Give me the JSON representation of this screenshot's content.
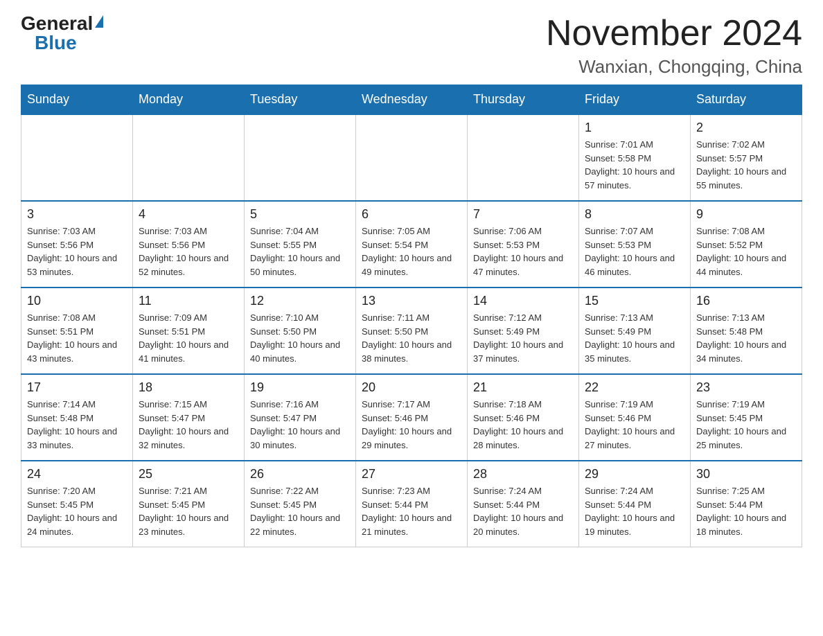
{
  "logo": {
    "general_text": "General",
    "blue_text": "Blue"
  },
  "header": {
    "month_year": "November 2024",
    "location": "Wanxian, Chongqing, China"
  },
  "weekdays": [
    "Sunday",
    "Monday",
    "Tuesday",
    "Wednesday",
    "Thursday",
    "Friday",
    "Saturday"
  ],
  "weeks": [
    [
      {
        "day": "",
        "info": ""
      },
      {
        "day": "",
        "info": ""
      },
      {
        "day": "",
        "info": ""
      },
      {
        "day": "",
        "info": ""
      },
      {
        "day": "",
        "info": ""
      },
      {
        "day": "1",
        "info": "Sunrise: 7:01 AM\nSunset: 5:58 PM\nDaylight: 10 hours and 57 minutes."
      },
      {
        "day": "2",
        "info": "Sunrise: 7:02 AM\nSunset: 5:57 PM\nDaylight: 10 hours and 55 minutes."
      }
    ],
    [
      {
        "day": "3",
        "info": "Sunrise: 7:03 AM\nSunset: 5:56 PM\nDaylight: 10 hours and 53 minutes."
      },
      {
        "day": "4",
        "info": "Sunrise: 7:03 AM\nSunset: 5:56 PM\nDaylight: 10 hours and 52 minutes."
      },
      {
        "day": "5",
        "info": "Sunrise: 7:04 AM\nSunset: 5:55 PM\nDaylight: 10 hours and 50 minutes."
      },
      {
        "day": "6",
        "info": "Sunrise: 7:05 AM\nSunset: 5:54 PM\nDaylight: 10 hours and 49 minutes."
      },
      {
        "day": "7",
        "info": "Sunrise: 7:06 AM\nSunset: 5:53 PM\nDaylight: 10 hours and 47 minutes."
      },
      {
        "day": "8",
        "info": "Sunrise: 7:07 AM\nSunset: 5:53 PM\nDaylight: 10 hours and 46 minutes."
      },
      {
        "day": "9",
        "info": "Sunrise: 7:08 AM\nSunset: 5:52 PM\nDaylight: 10 hours and 44 minutes."
      }
    ],
    [
      {
        "day": "10",
        "info": "Sunrise: 7:08 AM\nSunset: 5:51 PM\nDaylight: 10 hours and 43 minutes."
      },
      {
        "day": "11",
        "info": "Sunrise: 7:09 AM\nSunset: 5:51 PM\nDaylight: 10 hours and 41 minutes."
      },
      {
        "day": "12",
        "info": "Sunrise: 7:10 AM\nSunset: 5:50 PM\nDaylight: 10 hours and 40 minutes."
      },
      {
        "day": "13",
        "info": "Sunrise: 7:11 AM\nSunset: 5:50 PM\nDaylight: 10 hours and 38 minutes."
      },
      {
        "day": "14",
        "info": "Sunrise: 7:12 AM\nSunset: 5:49 PM\nDaylight: 10 hours and 37 minutes."
      },
      {
        "day": "15",
        "info": "Sunrise: 7:13 AM\nSunset: 5:49 PM\nDaylight: 10 hours and 35 minutes."
      },
      {
        "day": "16",
        "info": "Sunrise: 7:13 AM\nSunset: 5:48 PM\nDaylight: 10 hours and 34 minutes."
      }
    ],
    [
      {
        "day": "17",
        "info": "Sunrise: 7:14 AM\nSunset: 5:48 PM\nDaylight: 10 hours and 33 minutes."
      },
      {
        "day": "18",
        "info": "Sunrise: 7:15 AM\nSunset: 5:47 PM\nDaylight: 10 hours and 32 minutes."
      },
      {
        "day": "19",
        "info": "Sunrise: 7:16 AM\nSunset: 5:47 PM\nDaylight: 10 hours and 30 minutes."
      },
      {
        "day": "20",
        "info": "Sunrise: 7:17 AM\nSunset: 5:46 PM\nDaylight: 10 hours and 29 minutes."
      },
      {
        "day": "21",
        "info": "Sunrise: 7:18 AM\nSunset: 5:46 PM\nDaylight: 10 hours and 28 minutes."
      },
      {
        "day": "22",
        "info": "Sunrise: 7:19 AM\nSunset: 5:46 PM\nDaylight: 10 hours and 27 minutes."
      },
      {
        "day": "23",
        "info": "Sunrise: 7:19 AM\nSunset: 5:45 PM\nDaylight: 10 hours and 25 minutes."
      }
    ],
    [
      {
        "day": "24",
        "info": "Sunrise: 7:20 AM\nSunset: 5:45 PM\nDaylight: 10 hours and 24 minutes."
      },
      {
        "day": "25",
        "info": "Sunrise: 7:21 AM\nSunset: 5:45 PM\nDaylight: 10 hours and 23 minutes."
      },
      {
        "day": "26",
        "info": "Sunrise: 7:22 AM\nSunset: 5:45 PM\nDaylight: 10 hours and 22 minutes."
      },
      {
        "day": "27",
        "info": "Sunrise: 7:23 AM\nSunset: 5:44 PM\nDaylight: 10 hours and 21 minutes."
      },
      {
        "day": "28",
        "info": "Sunrise: 7:24 AM\nSunset: 5:44 PM\nDaylight: 10 hours and 20 minutes."
      },
      {
        "day": "29",
        "info": "Sunrise: 7:24 AM\nSunset: 5:44 PM\nDaylight: 10 hours and 19 minutes."
      },
      {
        "day": "30",
        "info": "Sunrise: 7:25 AM\nSunset: 5:44 PM\nDaylight: 10 hours and 18 minutes."
      }
    ]
  ]
}
